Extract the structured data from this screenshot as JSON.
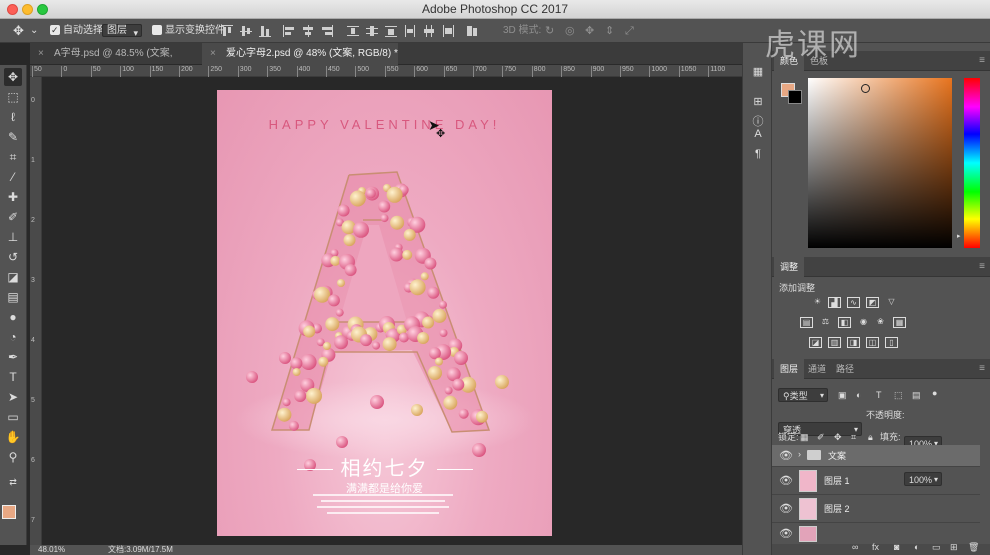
{
  "window": {
    "title": "Adobe Photoshop CC 2017"
  },
  "options": {
    "auto_select_label": "自动选择:",
    "auto_select_target": "图层",
    "show_transform_label": "显示变换控件",
    "mode_3d_label": "3D 模式:"
  },
  "tabs": [
    {
      "label": "A字母.psd @ 48.5% (文案, RGB/8) *",
      "active": false
    },
    {
      "label": "爱心字母2.psd @ 48% (文案, RGB/8) *",
      "active": true
    }
  ],
  "ruler": {
    "h_ticks": [
      "50",
      "0",
      "50",
      "100",
      "150",
      "200",
      "250",
      "300",
      "350",
      "400",
      "450",
      "500",
      "550",
      "600",
      "650",
      "700",
      "750",
      "800",
      "850",
      "900",
      "950",
      "1000",
      "1050",
      "1100"
    ]
  },
  "poster": {
    "title": "HAPPY VALENTINE DAY!",
    "main_text": "相约七夕",
    "sub_text": "满满都是给你爱"
  },
  "status": {
    "zoom": "48.01%",
    "doc_info": "文档:3.09M/17.5M"
  },
  "watermark": "虎课网",
  "color_panel": {
    "tabs": [
      "颜色",
      "色板"
    ],
    "fg_color": "#e8a884",
    "bg_color": "#000000"
  },
  "adjust_panel": {
    "title": "调整",
    "add_label": "添加调整"
  },
  "layers_panel": {
    "tabs": [
      "图层",
      "通道",
      "路径"
    ],
    "kind_filter": "类型",
    "blend_mode": "穿透",
    "opacity_label": "不透明度:",
    "opacity_value": "100%",
    "lock_label": "锁定:",
    "fill_label": "填充:",
    "fill_value": "100%",
    "layers": [
      {
        "name": "文案",
        "type": "group"
      },
      {
        "name": "图层 1",
        "type": "layer"
      },
      {
        "name": "图层 2",
        "type": "layer"
      }
    ]
  }
}
